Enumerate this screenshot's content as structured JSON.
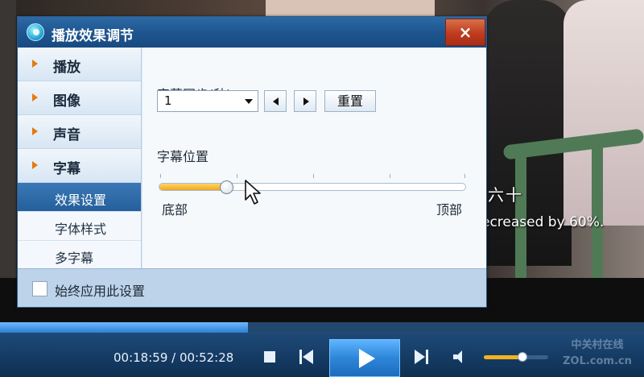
{
  "dialog": {
    "title": "播放效果调节",
    "close_label": "×",
    "categories": [
      {
        "label": "播放"
      },
      {
        "label": "图像"
      },
      {
        "label": "声音"
      },
      {
        "label": "字幕"
      }
    ],
    "subtitle_items": [
      {
        "label": "效果设置",
        "active": true
      },
      {
        "label": "字体样式",
        "active": false
      },
      {
        "label": "多字幕",
        "active": false
      }
    ],
    "sync": {
      "label": "字幕同步(秒)",
      "value": "1",
      "reset_label": "重置"
    },
    "position": {
      "label": "字幕位置",
      "min_label": "底部",
      "max_label": "顶部",
      "level": 0.22
    },
    "footer": {
      "checkbox_label": "始终应用此设置",
      "checked": false
    }
  },
  "video": {
    "subtitle_line1": "六十",
    "subtitle_line2": "ecreased by 60%."
  },
  "player": {
    "time": "00:18:59 / 00:52:28",
    "progress": 0.385,
    "volume": 0.6,
    "watermark_line1": "中关村在线",
    "watermark_line2": "ZOL.com.cn"
  },
  "colors": {
    "accent": "#f0a81d",
    "titlebar": "#1f5690",
    "close": "#c03b1e",
    "active_item": "#2e6aa8"
  },
  "icons": [
    "app-icon",
    "close-icon",
    "arrow-right-icon",
    "dropdown-icon",
    "prev-arrow-icon",
    "next-arrow-icon",
    "stop-icon",
    "previous-icon",
    "play-icon",
    "next-icon",
    "volume-icon",
    "cursor-icon"
  ]
}
